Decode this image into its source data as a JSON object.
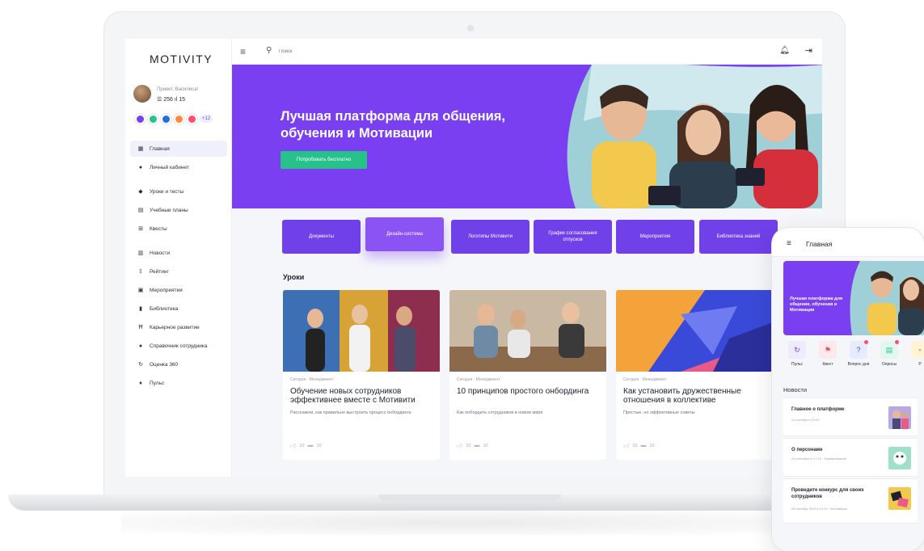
{
  "laptop": {
    "logo": "MOTIVITY",
    "profile": {
      "greeting": "Привет, Василиса!",
      "stats": "☰ 256   ıl 15",
      "badges_more": "+12",
      "badge_colors": [
        "#7b3ff2",
        "#27c28a",
        "#1f6fe0",
        "#ff8a3d",
        "#ff4f6b"
      ]
    },
    "nav": [
      {
        "label": "Главная",
        "icon": "home-icon",
        "active": true
      },
      {
        "label": "Личный кабинет",
        "icon": "user-icon"
      },
      {
        "label": "Уроки и тесты",
        "icon": "graduation-cap-icon"
      },
      {
        "label": "Учебные планы",
        "icon": "book-open-icon"
      },
      {
        "label": "Квесты",
        "icon": "puzzle-icon"
      },
      {
        "label": "Новости",
        "icon": "newspaper-icon"
      },
      {
        "label": "Рейтинг",
        "icon": "trophy-icon"
      },
      {
        "label": "Мероприятия",
        "icon": "calendar-icon"
      },
      {
        "label": "Библиотека",
        "icon": "library-icon"
      },
      {
        "label": "Карьерное развитие",
        "icon": "ladder-icon"
      },
      {
        "label": "Справочник сотрудника",
        "icon": "contacts-icon"
      },
      {
        "label": "Оценка 360",
        "icon": "rotate-icon"
      },
      {
        "label": "Пульс",
        "icon": "pulse-icon"
      }
    ],
    "topbar": {
      "search_placeholder": "Поиск"
    },
    "hero": {
      "title": "Лучшая платформа для общения, обучения и Мотивации",
      "button": "Попробовать бесплатно"
    },
    "categories": [
      {
        "label": "Документы"
      },
      {
        "label": "Дизайн-система",
        "active": true
      },
      {
        "label": "Логотипы Мотивити"
      },
      {
        "label": "График согласования отпусков"
      },
      {
        "label": "Мероприятия"
      },
      {
        "label": "Библиотека знаний"
      }
    ],
    "lessons_title": "Уроки",
    "lessons": [
      {
        "meta": "Сегодня · Менеджмент",
        "title": "Обучение новых сотрудников эффективнее вместе с Мотивити",
        "desc": "Расскажем, как правильно выстроить процесс онбординга",
        "likes": "10",
        "comments": "10"
      },
      {
        "meta": "Сегодня · Менеджмент",
        "title": "10 принципов простого онбординга",
        "desc": "Как онбордить сотрудников в новом мире",
        "likes": "10",
        "comments": "10"
      },
      {
        "meta": "Сегодня · Менеджмент",
        "title": "Как установить дружественные отношения в коллективе",
        "desc": "Простые, но эффективные советы",
        "likes": "10",
        "comments": "10"
      }
    ]
  },
  "phone": {
    "title": "Главная",
    "hero_title": "Лучшая платформа для общения, обучения и Мотивации",
    "quick": [
      {
        "label": "Пульс",
        "icon": "pulse-icon"
      },
      {
        "label": "Квест",
        "icon": "quest-icon"
      },
      {
        "label": "Вопрос дня",
        "icon": "question-icon"
      },
      {
        "label": "Опросы",
        "icon": "poll-icon"
      },
      {
        "label": "Р",
        "icon": "more-icon"
      }
    ],
    "news_title": "Новости",
    "news": [
      {
        "title": "Главное о платформе",
        "meta": "10 октября в 12:00"
      },
      {
        "title": "О персонаже",
        "meta": "21 сентября в 17:19 · Коммуникации"
      },
      {
        "title": "Проведите конкурс для своих сотрудников",
        "meta": "26 октября 2019 в 10:19 · Мотивация"
      }
    ]
  }
}
